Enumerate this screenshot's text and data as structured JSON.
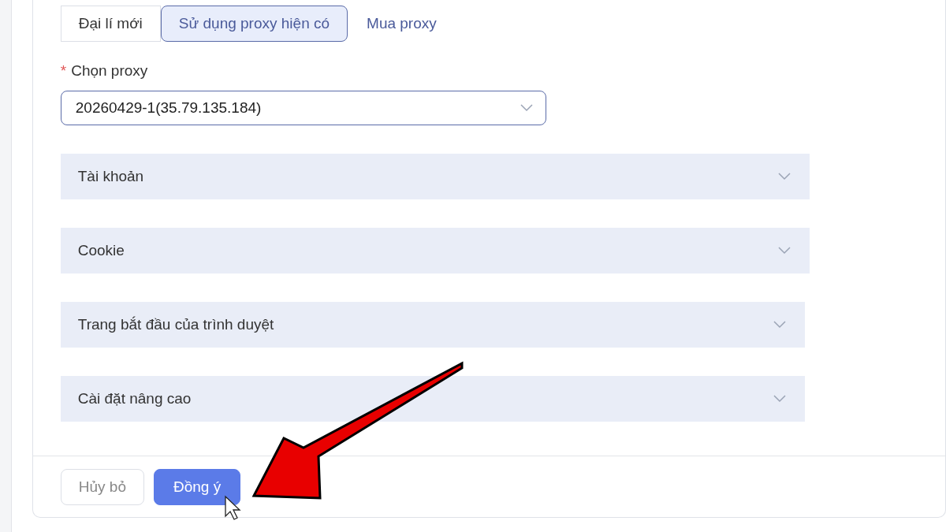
{
  "tabs": [
    {
      "label": "Đại lí mới",
      "kind": "tab",
      "selected": false
    },
    {
      "label": "Sử dụng proxy hiện có",
      "kind": "tab",
      "selected": true
    },
    {
      "label": "Mua proxy",
      "kind": "link",
      "selected": false
    }
  ],
  "proxy_field": {
    "label": "Chọn proxy",
    "required": true,
    "required_mark": "*",
    "value": "20260429-1(35.79.135.184)"
  },
  "sections": [
    {
      "title": "Tài khoản",
      "expanded": false
    },
    {
      "title": "Cookie",
      "expanded": false
    },
    {
      "title": "Trang bắt đầu của trình duyệt",
      "expanded": false
    },
    {
      "title": "Cài đặt nâng cao",
      "expanded": false
    }
  ],
  "buttons": [
    {
      "label": "Hủy bỏ",
      "kind": "secondary"
    },
    {
      "label": "Đồng ý",
      "kind": "primary"
    }
  ]
}
